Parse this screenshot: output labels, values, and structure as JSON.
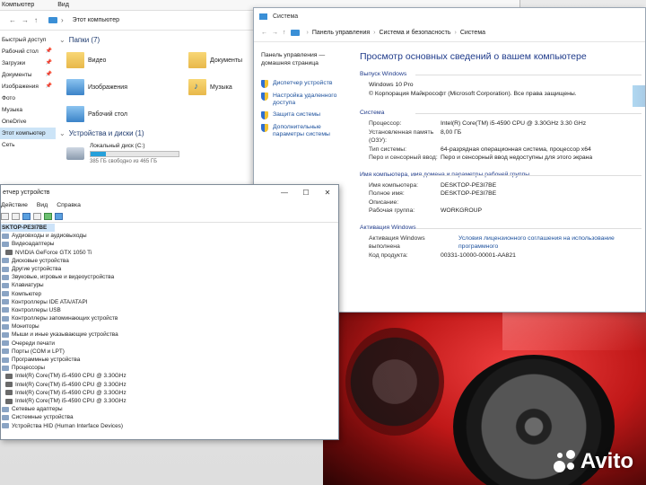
{
  "explorer": {
    "ribbon": [
      "Компьютер",
      "Вид"
    ],
    "breadcrumb": "Этот компьютер",
    "sidebar": [
      {
        "label": "Быстрый доступ",
        "pinned": false
      },
      {
        "label": "Рабочий стол",
        "pinned": true
      },
      {
        "label": "Загрузки",
        "pinned": true
      },
      {
        "label": "Документы",
        "pinned": true
      },
      {
        "label": "Изображения",
        "pinned": true
      },
      {
        "label": "Фото",
        "pinned": false
      },
      {
        "label": "Музыка",
        "pinned": false
      },
      {
        "label": "OneDrive",
        "pinned": false
      },
      {
        "label": "Этот компьютер",
        "pinned": false
      },
      {
        "label": "Сеть",
        "pinned": false
      }
    ],
    "folders_header": "Папки (7)",
    "folders": [
      {
        "label": "Видео",
        "icon": "video-folder-icon"
      },
      {
        "label": "Документы",
        "icon": "documents-folder-icon"
      },
      {
        "label": "Изображения",
        "icon": "pictures-folder-icon"
      },
      {
        "label": "Музыка",
        "icon": "music-folder-icon"
      },
      {
        "label": "Рабочий стол",
        "icon": "desktop-folder-icon"
      }
    ],
    "drives_header": "Устройства и диски (1)",
    "drive": {
      "label": "Локальный диск (C:)",
      "free": "385 ГБ свободно из 465 ГБ",
      "used_fraction": 0.17
    }
  },
  "system": {
    "title": "Система",
    "breadcrumb": [
      "Панель управления",
      "Система и безопасность",
      "Система"
    ],
    "home_link": "Панель управления — домашняя страница",
    "left_links": [
      "Диспетчер устройств",
      "Настройка удаленного доступа",
      "Защита системы",
      "Дополнительные параметры системы"
    ],
    "heading": "Просмотр основных сведений о вашем компьютере",
    "windows_section": "Выпуск Windows",
    "windows_edition": "Windows 10 Pro",
    "copyright": "© Корпорация Майкрософт (Microsoft Corporation). Все права защищены.",
    "system_section": "Система",
    "system_rows": [
      {
        "k": "Процессор:",
        "v": "Intel(R) Core(TM) i5-4590 CPU @ 3.30GHz   3.30 GHz"
      },
      {
        "k": "Установленная память (ОЗУ):",
        "v": "8,00 ГБ"
      },
      {
        "k": "Тип системы:",
        "v": "64-разрядная операционная система, процессор x64"
      },
      {
        "k": "Перо и сенсорный ввод:",
        "v": "Перо и сенсорный ввод недоступны для этого экрана"
      }
    ],
    "name_section": "Имя компьютера, имя домена и параметры рабочей группы",
    "name_rows": [
      {
        "k": "Имя компьютера:",
        "v": "DESKTOP-PE3I7BE"
      },
      {
        "k": "Полное имя:",
        "v": "DESKTOP-PE3I7BE"
      },
      {
        "k": "Описание:",
        "v": ""
      },
      {
        "k": "Рабочая группа:",
        "v": "WORKGROUP"
      }
    ],
    "activation_section": "Активация Windows",
    "activation_status": "Активация Windows выполнена",
    "activation_link": "Условия лицензионного соглашения на использование программного",
    "product_key_label": "Код продукта:",
    "product_key": "00331-10000-00001-AA821"
  },
  "devmgr": {
    "title": "етчер устройств",
    "menu": [
      "Действие",
      "Вид",
      "Справка"
    ],
    "root": "SKTOP-PE3I7BE",
    "tree": [
      {
        "label": "Аудиовходы и аудиовыходы",
        "level": 1
      },
      {
        "label": "Видеоадаптеры",
        "level": 1
      },
      {
        "label": "NVIDIA GeForce GTX 1050 Ti",
        "level": 2
      },
      {
        "label": "Дисковые устройства",
        "level": 1
      },
      {
        "label": "Другие устройства",
        "level": 1
      },
      {
        "label": "Звуковые, игровые и видеоустройства",
        "level": 1
      },
      {
        "label": "Клавиатуры",
        "level": 1
      },
      {
        "label": "Компьютер",
        "level": 1
      },
      {
        "label": "Контроллеры IDE ATA/ATAPI",
        "level": 1
      },
      {
        "label": "Контроллеры USB",
        "level": 1
      },
      {
        "label": "Контроллеры запоминающих устройств",
        "level": 1
      },
      {
        "label": "Мониторы",
        "level": 1
      },
      {
        "label": "Мыши и иные указывающие устройства",
        "level": 1
      },
      {
        "label": "Очереди печати",
        "level": 1
      },
      {
        "label": "Порты (COM и LPT)",
        "level": 1
      },
      {
        "label": "Программные устройства",
        "level": 1
      },
      {
        "label": "Процессоры",
        "level": 1
      },
      {
        "label": "Intel(R) Core(TM) i5-4590 CPU @ 3.30GHz",
        "level": 2
      },
      {
        "label": "Intel(R) Core(TM) i5-4590 CPU @ 3.30GHz",
        "level": 2
      },
      {
        "label": "Intel(R) Core(TM) i5-4590 CPU @ 3.30GHz",
        "level": 2
      },
      {
        "label": "Intel(R) Core(TM) i5-4590 CPU @ 3.30GHz",
        "level": 2
      },
      {
        "label": "Сетевые адаптеры",
        "level": 1
      },
      {
        "label": "Системные устройства",
        "level": 1
      },
      {
        "label": "Устройства HID (Human Interface Devices)",
        "level": 1
      }
    ]
  },
  "watermark": "Avito"
}
